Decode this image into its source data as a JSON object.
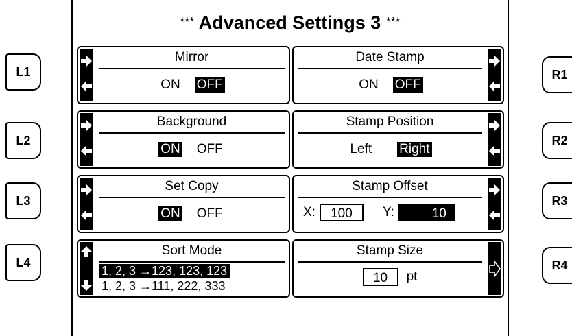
{
  "screen": {
    "title_stars": "***",
    "title": "Advanced Settings 3"
  },
  "buttons": {
    "L1": "L1",
    "L2": "L2",
    "L3": "L3",
    "L4": "L4",
    "R1": "R1",
    "R2": "R2",
    "R3": "R3",
    "R4": "R4"
  },
  "mirror": {
    "label": "Mirror",
    "on": "ON",
    "off": "OFF",
    "selected": "OFF"
  },
  "background": {
    "label": "Background",
    "on": "ON",
    "off": "OFF",
    "selected": "ON"
  },
  "set_copy": {
    "label": "Set Copy",
    "on": "ON",
    "off": "OFF",
    "selected": "ON"
  },
  "sort_mode": {
    "label": "Sort Mode",
    "options": [
      "1, 2, 3 →123, 123, 123",
      "1, 2, 3 →111, 222, 333"
    ],
    "selected_index": 0
  },
  "date_stamp": {
    "label": "Date Stamp",
    "on": "ON",
    "off": "OFF",
    "selected": "OFF"
  },
  "stamp_position": {
    "label": "Stamp Position",
    "left": "Left",
    "right": "Right",
    "selected": "Right"
  },
  "stamp_offset": {
    "label": "Stamp Offset",
    "x_label": "X:",
    "x_value": "100",
    "y_label": "Y:",
    "y_value": "10"
  },
  "stamp_size": {
    "label": "Stamp Size",
    "value": "10",
    "unit": "pt"
  }
}
